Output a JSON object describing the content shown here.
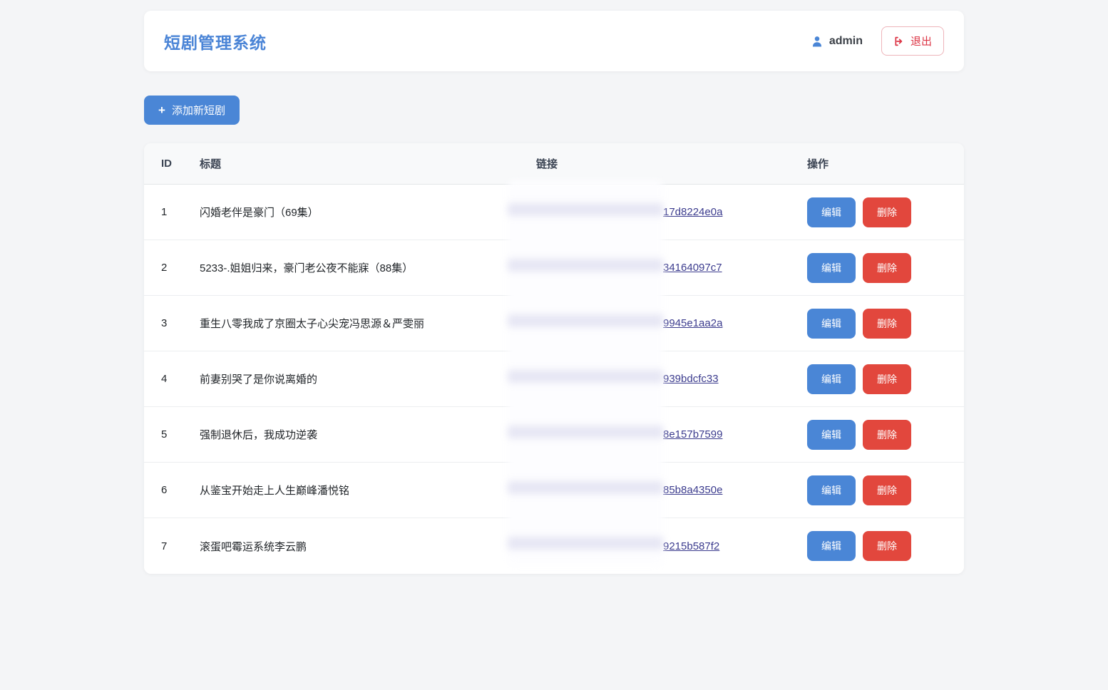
{
  "app": {
    "title": "短剧管理系统",
    "user": "admin",
    "logout_label": "退出"
  },
  "toolbar": {
    "add_label": "添加新短剧",
    "plus_glyph": "+"
  },
  "table": {
    "headers": {
      "id": "ID",
      "title": "标题",
      "link": "链接",
      "actions": "操作"
    },
    "action_labels": {
      "edit": "编辑",
      "delete": "删除"
    },
    "rows": [
      {
        "id": "1",
        "title": "闪婚老伴是豪门（69集）",
        "link_visible": "17d8224e0a"
      },
      {
        "id": "2",
        "title": "5233-.姐姐归来，豪门老公夜不能寐（88集）",
        "link_visible": "34164097c7"
      },
      {
        "id": "3",
        "title": "重生八零我成了京圈太子心尖宠冯思源＆严雯丽",
        "link_visible": "9945e1aa2a"
      },
      {
        "id": "4",
        "title": "前妻别哭了是你说离婚的",
        "link_visible": "939bdcfc33"
      },
      {
        "id": "5",
        "title": "强制退休后，我成功逆袭",
        "link_visible": "8e157b7599"
      },
      {
        "id": "6",
        "title": "从鉴宝开始走上人生巅峰潘悦铭",
        "link_visible": "85b8a4350e"
      },
      {
        "id": "7",
        "title": "滚蛋吧霉运系统李云鹏",
        "link_visible": "9215b587f2"
      }
    ]
  },
  "colors": {
    "accent_blue": "#4a86d6",
    "title_blue": "#4a84d6",
    "danger_red": "#e2473d",
    "logout_red": "#dc3545",
    "link_navy": "#3c3c8e",
    "page_bg": "#f4f5f7"
  },
  "icons": {
    "user": "user-icon",
    "logout": "logout-icon",
    "plus": "plus-icon"
  }
}
